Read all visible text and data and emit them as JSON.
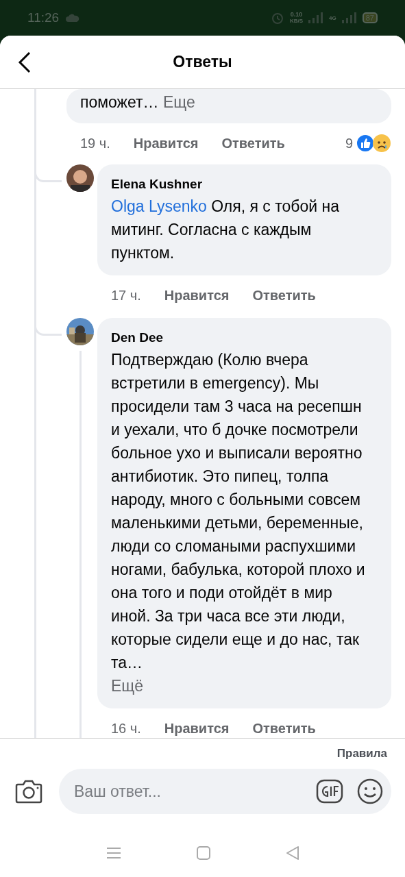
{
  "status_bar": {
    "time": "11:26",
    "network_speed": "0.10",
    "speed_unit": "KB/S",
    "network_type": "4G",
    "battery": "87"
  },
  "header": {
    "title": "Ответы"
  },
  "comments": [
    {
      "kind": "truncated",
      "text": "поможет…",
      "more": "Еще",
      "time": "19 ч.",
      "like": "Нравится",
      "reply": "Ответить",
      "reaction_count": "9"
    },
    {
      "kind": "full",
      "author": "Elena Kushner",
      "mention": "Olga Lysenko",
      "text": "Оля, я с тобой на митинг. Согласна с каждым пунктом.",
      "time": "17 ч.",
      "like": "Нравится",
      "reply": "Ответить"
    },
    {
      "kind": "full",
      "author": "Den Dee",
      "text": "Подтверждаю (Колю вчера встретили в emergency). Мы просидели там 3 часа на ресепшн и уехали, что б дочке посмотрели больное ухо и выписали вероятно антибиотик. Это пипец, толпа народу, много с больными совсем маленькими детьми, беременные, люди со сломаными распухшими ногами, бабулька, которой плохо и она того и поди отойдёт в мир иной. За три часа все эти люди, которые сидели еще и до нас, так та…",
      "more": "Ещё",
      "time": "16 ч.",
      "like": "Нравится",
      "reply": "Ответить"
    }
  ],
  "composer": {
    "rules": "Правила",
    "placeholder": "Ваш ответ..."
  }
}
